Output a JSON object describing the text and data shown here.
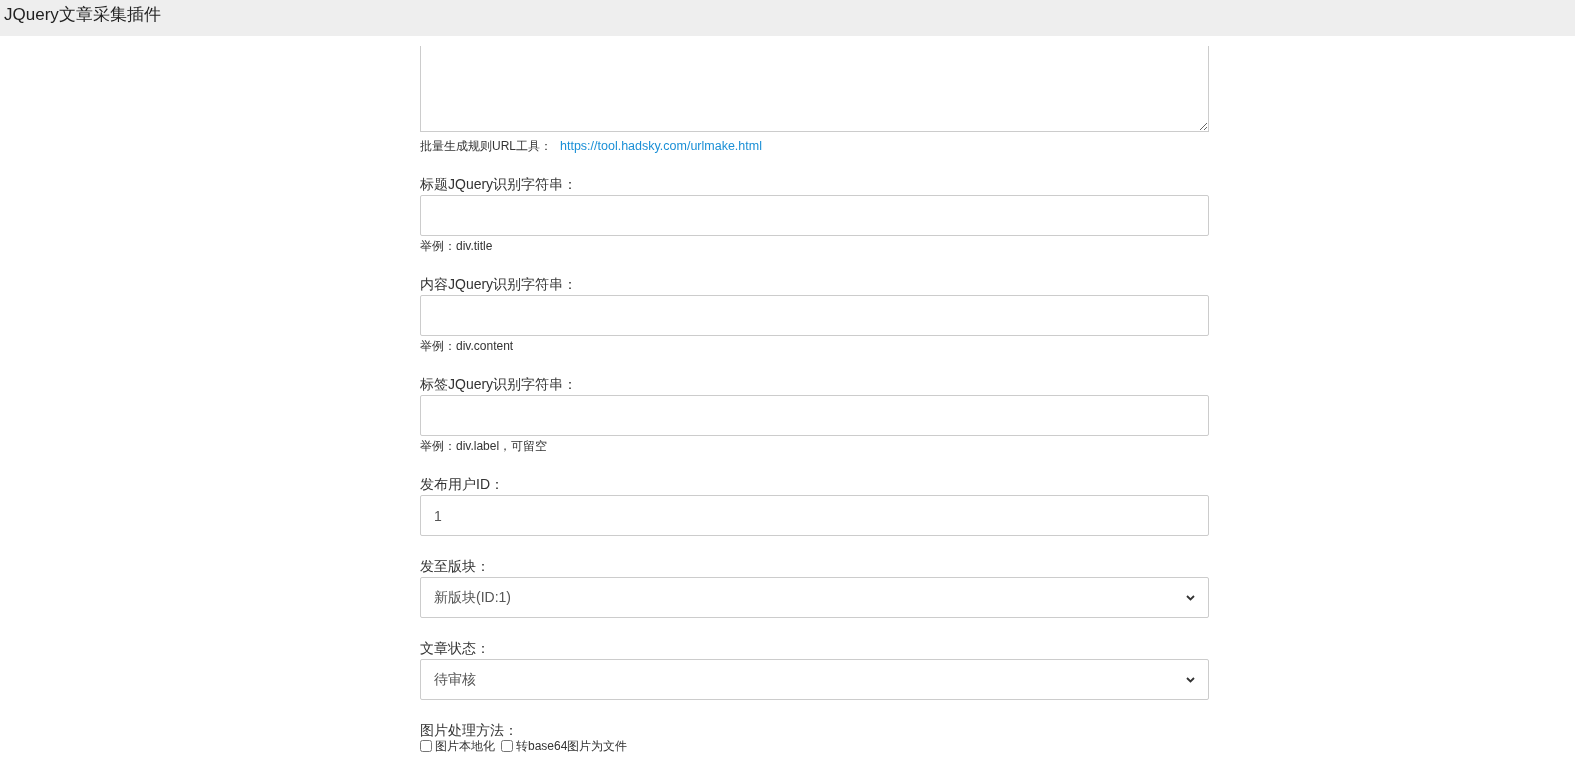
{
  "header": {
    "title": "JQuery文章采集插件"
  },
  "url_area": {
    "hint_label": "批量生成规则URL工具：",
    "hint_link": "https://tool.hadsky.com/urlmake.html"
  },
  "fields": [
    {
      "kind": "text",
      "label": "标题JQuery识别字符串：",
      "hint": "举例：div.title"
    },
    {
      "kind": "text",
      "label": "内容JQuery识别字符串：",
      "hint": "举例：div.content"
    },
    {
      "kind": "text",
      "label": "标签JQuery识别字符串：",
      "hint": "举例：div.label，可留空"
    },
    {
      "kind": "text",
      "label": "发布用户ID：",
      "value": "1"
    },
    {
      "kind": "select",
      "label": "发至版块：",
      "value": "新版块(ID:1)"
    },
    {
      "kind": "select",
      "label": "文章状态：",
      "value": "待审核"
    }
  ],
  "image_processing": {
    "label": "图片处理方法：",
    "options": [
      {
        "label": "图片本地化",
        "checked": false
      },
      {
        "label": "转base64图片为文件",
        "checked": false
      }
    ]
  }
}
